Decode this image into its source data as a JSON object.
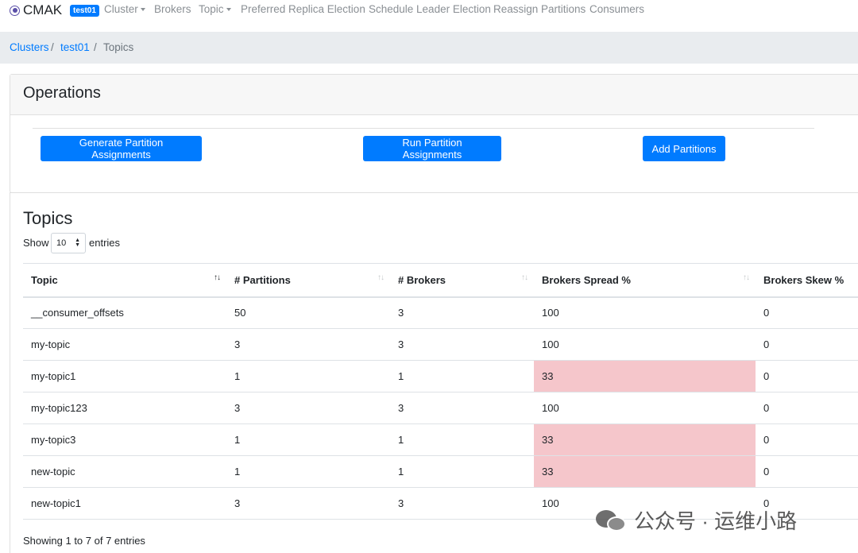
{
  "navbar": {
    "brand": "CMAK",
    "cluster_badge": "test01",
    "items": [
      {
        "label": "Cluster",
        "dropdown": true
      },
      {
        "label": "Brokers",
        "dropdown": false
      },
      {
        "label": "Topic",
        "dropdown": true
      },
      {
        "label": "Preferred Replica Election",
        "dropdown": false
      },
      {
        "label": "Schedule Leader Election",
        "dropdown": false
      },
      {
        "label": "Reassign Partitions",
        "dropdown": false
      },
      {
        "label": "Consumers",
        "dropdown": false
      }
    ]
  },
  "breadcrumb": {
    "items": [
      "Clusters",
      "test01",
      "Topics"
    ],
    "separator": "/"
  },
  "operations": {
    "title": "Operations",
    "buttons": {
      "generate": "Generate Partition Assignments",
      "run": "Run Partition Assignments",
      "add": "Add Partitions"
    }
  },
  "topics": {
    "title": "Topics",
    "show_label": "Show",
    "page_length": "10",
    "entries_label": "entries",
    "columns": [
      "Topic",
      "# Partitions",
      "# Brokers",
      "Brokers Spread %",
      "Brokers Skew %"
    ],
    "rows": [
      {
        "topic": "__consumer_offsets",
        "partitions": "50",
        "brokers": "3",
        "spread": "100",
        "skew": "0"
      },
      {
        "topic": "my-topic",
        "partitions": "3",
        "brokers": "3",
        "spread": "100",
        "skew": "0"
      },
      {
        "topic": "my-topic1",
        "partitions": "1",
        "brokers": "1",
        "spread": "33",
        "skew": "0"
      },
      {
        "topic": "my-topic123",
        "partitions": "3",
        "brokers": "3",
        "spread": "100",
        "skew": "0"
      },
      {
        "topic": "my-topic3",
        "partitions": "1",
        "brokers": "1",
        "spread": "33",
        "skew": "0"
      },
      {
        "topic": "new-topic",
        "partitions": "1",
        "brokers": "1",
        "spread": "33",
        "skew": "0"
      },
      {
        "topic": "new-topic1",
        "partitions": "3",
        "brokers": "3",
        "spread": "100",
        "skew": "0"
      }
    ],
    "info": "Showing 1 to 7 of 7 entries"
  },
  "watermark": {
    "text": "公众号 · 运维小路",
    "icon": "wechat-icon"
  },
  "colors": {
    "primary": "#007bff",
    "warning_cell": "#f5c6cb",
    "breadcrumb_bg": "#e9ecef"
  }
}
